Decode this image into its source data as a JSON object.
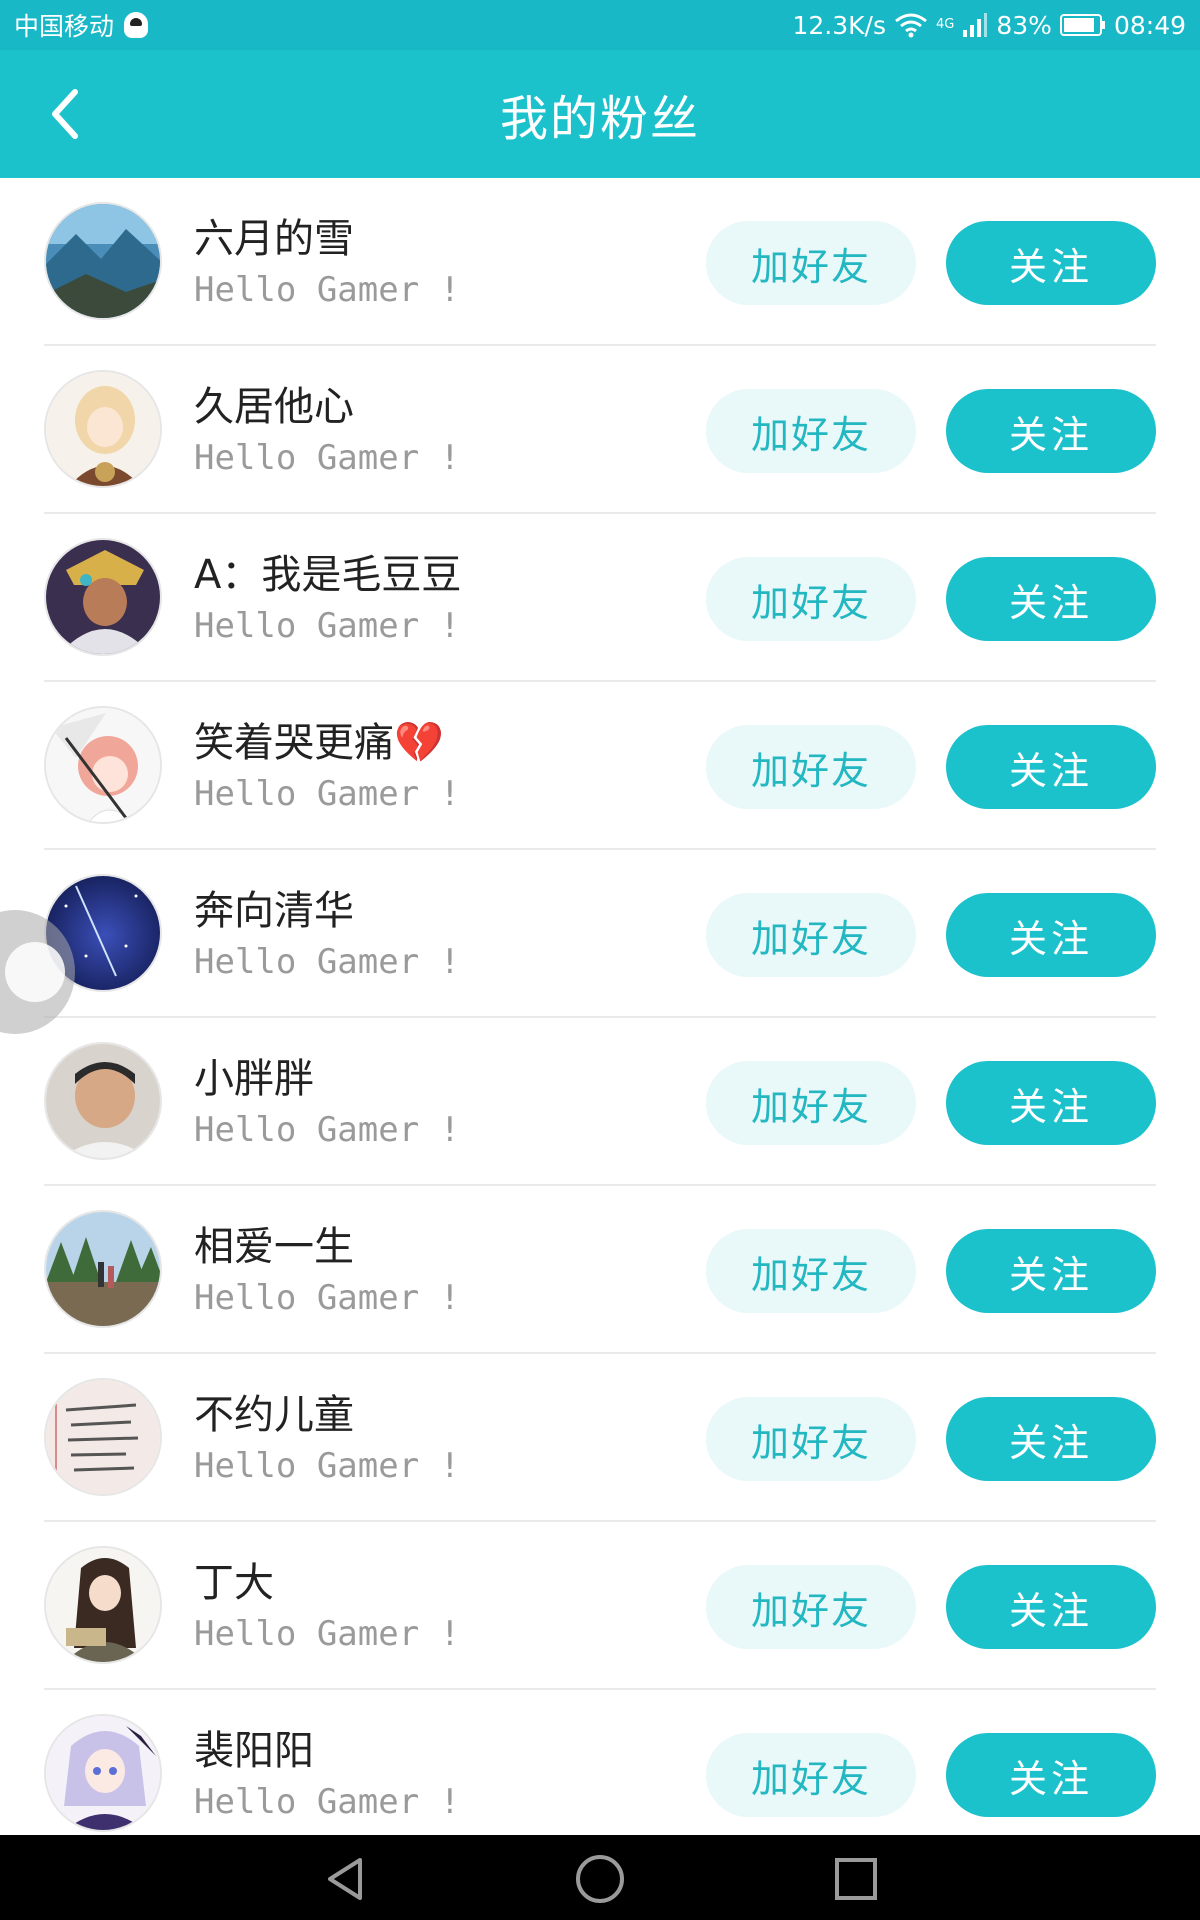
{
  "status_bar": {
    "carrier": "中国移动",
    "net_speed": "12.3K/s",
    "network_type": "4G",
    "battery": "83%",
    "time": "08:49"
  },
  "header": {
    "title": "我的粉丝"
  },
  "fans": [
    {
      "name": "六月的雪",
      "greeting": "Hello Gamer !",
      "add_friend": "加好友",
      "follow": "关注"
    },
    {
      "name": "久居他心",
      "greeting": "Hello Gamer !",
      "add_friend": "加好友",
      "follow": "关注"
    },
    {
      "name": "A：我是毛豆豆",
      "greeting": "Hello Gamer !",
      "add_friend": "加好友",
      "follow": "关注"
    },
    {
      "name": "笑着哭更痛💔",
      "greeting": "Hello Gamer !",
      "add_friend": "加好友",
      "follow": "关注"
    },
    {
      "name": "奔向清华",
      "greeting": "Hello Gamer !",
      "add_friend": "加好友",
      "follow": "关注"
    },
    {
      "name": "小胖胖",
      "greeting": "Hello Gamer !",
      "add_friend": "加好友",
      "follow": "关注"
    },
    {
      "name": "相爱一生",
      "greeting": "Hello Gamer !",
      "add_friend": "加好友",
      "follow": "关注"
    },
    {
      "name": "不约儿童",
      "greeting": "Hello Gamer !",
      "add_friend": "加好友",
      "follow": "关注"
    },
    {
      "name": "丁大",
      "greeting": "Hello Gamer !",
      "add_friend": "加好友",
      "follow": "关注"
    },
    {
      "name": "裴阳阳",
      "greeting": "Hello Gamer !",
      "add_friend": "加好友",
      "follow": "关注"
    }
  ],
  "colors": {
    "accent": "#1bc2cc",
    "add_friend_bg": "#e9f8f9",
    "add_friend_text": "#23b7c2"
  }
}
